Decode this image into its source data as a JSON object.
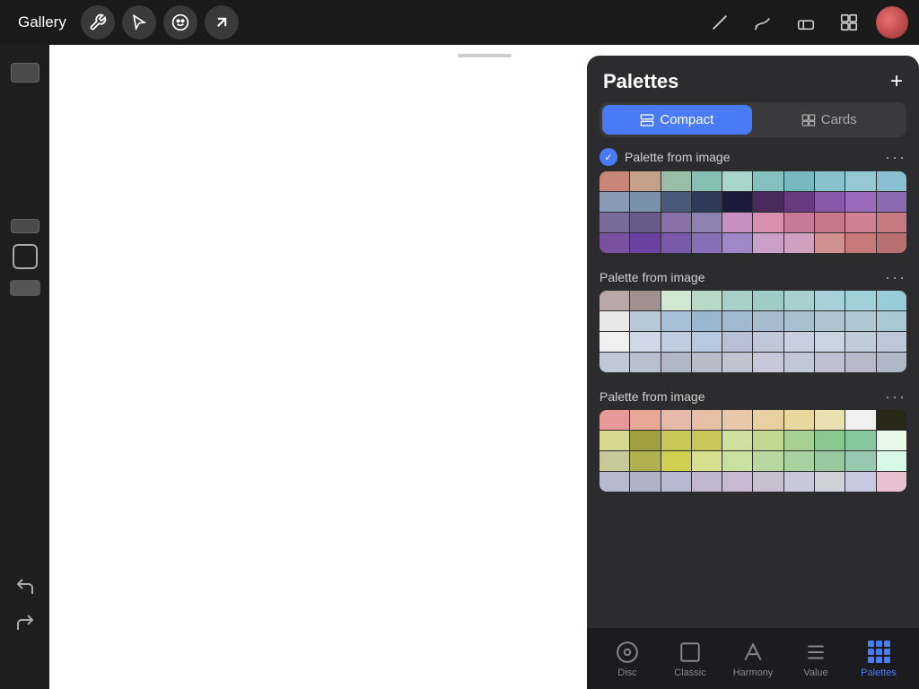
{
  "toolbar": {
    "gallery_label": "Gallery",
    "add_label": "+",
    "panel_title": "Palettes"
  },
  "tabs": [
    {
      "id": "compact",
      "label": "Compact",
      "active": true
    },
    {
      "id": "cards",
      "label": "Cards",
      "active": false
    }
  ],
  "palettes": [
    {
      "name": "Palette from image",
      "checked": true,
      "rows": [
        [
          "#c8857a",
          "#c4a08a",
          "#9abfa8",
          "#86c0b4",
          "#a8d5cc",
          "#85bfbe",
          "#78b8c0",
          "#89c2cc",
          "#96c8d4",
          "#8abfd4"
        ],
        [
          "#8a9ab5",
          "#7890a8",
          "#4a5a7a",
          "#2e3a5a",
          "#1a1a3a",
          "#4a2a5a",
          "#6a3a80",
          "#8a5aaa",
          "#9a6aba",
          "#8a6ab0"
        ],
        [
          "#7a6a9a",
          "#6a5a8a",
          "#8a70a8",
          "#9080b0",
          "#c890c0",
          "#d890b0",
          "#c87898",
          "#c87888",
          "#d08090",
          "#c87880"
        ],
        [
          "#7a50a0",
          "#6a40a0",
          "#7a5aaa",
          "#8870b8",
          "#a088c8",
          "#c8a0c8",
          "#d0a0c0",
          "#d09090",
          "#c87878",
          "#b87070"
        ]
      ]
    },
    {
      "name": "Palette from image",
      "checked": false,
      "rows": [
        [
          "#b8a8a8",
          "#a09090",
          "#d0e8d0",
          "#b8d8c8",
          "#a8d0c8",
          "#a0ccc8",
          "#a8d0d0",
          "#a8d0d8",
          "#a0d0d8",
          "#98ccd8"
        ],
        [
          "#e8e8e8",
          "#b8c8d8",
          "#a8c0d8",
          "#98b8d0",
          "#a0b8d0",
          "#a8bcd0",
          "#a8c0d0",
          "#b0c4d0",
          "#b0c8d4",
          "#a8c8d4"
        ],
        [
          "#f0f0f0",
          "#d0d8e8",
          "#c0cce0",
          "#b8c8e0",
          "#b8c0d8",
          "#c0c8d8",
          "#c8d0e0",
          "#c8d4e0",
          "#c0ccd8",
          "#bcc8d8"
        ],
        [
          "#c0c8d8",
          "#b8c0d0",
          "#b0b8c8",
          "#b8bcc8",
          "#c0c4d0",
          "#c8c8d8",
          "#c0c8d8",
          "#c0c0d0",
          "#b8b8c8",
          "#b0b8c8"
        ]
      ]
    },
    {
      "name": "Palette from image",
      "checked": false,
      "rows": [
        [
          "#e89898",
          "#e8a898",
          "#e8b8a8",
          "#e8c0a8",
          "#e8c8a8",
          "#e8d0a0",
          "#e8d8a0",
          "#e8e0b0",
          "#f0f0f0",
          "#282818"
        ],
        [
          "#d8d890",
          "#a0a040",
          "#c8c858",
          "#c8c858",
          "#d0e0a0",
          "#c0d890",
          "#a8d090",
          "#88c890",
          "#88c8a0",
          "#e8f8e8"
        ],
        [
          "#c8c898",
          "#b0b050",
          "#d0d050",
          "#d8e090",
          "#c8e0a0",
          "#b8d8a0",
          "#a8d0a0",
          "#98c8a0",
          "#98c8b0",
          "#d8f8e8"
        ],
        [
          "#b8b8d0",
          "#b0b0c8",
          "#b8b8d0",
          "#c0b8d0",
          "#c8b8d0",
          "#c8c0d0",
          "#c8c8d8",
          "#d0d0d8",
          "#c8c8e0",
          "#e8c0d0"
        ]
      ]
    }
  ],
  "bottom_nav": [
    {
      "id": "disc",
      "label": "Disc",
      "active": false
    },
    {
      "id": "classic",
      "label": "Classic",
      "active": false
    },
    {
      "id": "harmony",
      "label": "Harmony",
      "active": false
    },
    {
      "id": "value",
      "label": "Value",
      "active": false
    },
    {
      "id": "palettes",
      "label": "Palettes",
      "active": true
    }
  ],
  "icons": {
    "pen": "✏",
    "modify": "⚙",
    "smudge": "S",
    "arrow": "↗",
    "stroke": "╱",
    "brush": "⌒",
    "eraser": "◻",
    "layers": "⊞"
  }
}
